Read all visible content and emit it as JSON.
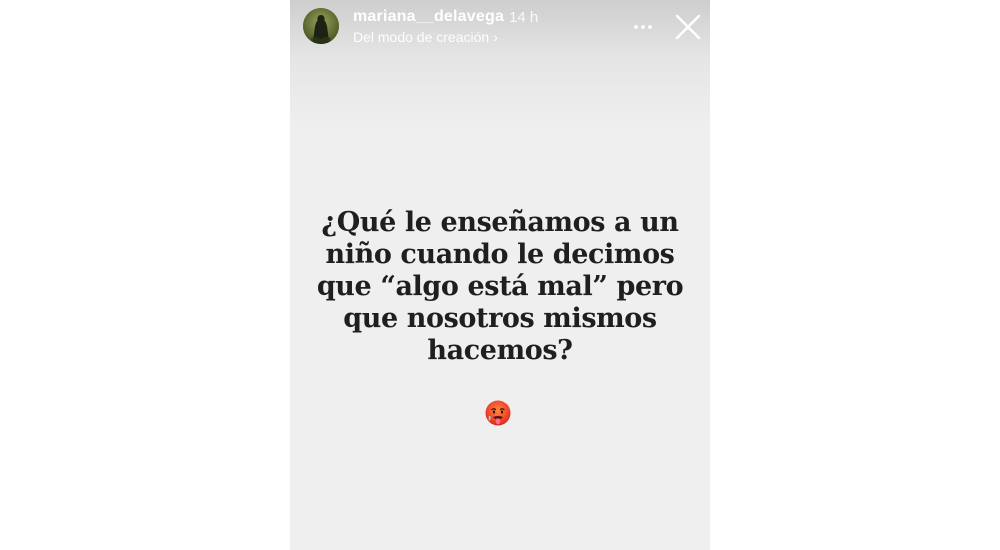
{
  "story": {
    "username": "mariana__delavega",
    "timestamp": "14 h",
    "subtitle": "Del modo de creación",
    "subtitle_chevron": "›",
    "question_lines": [
      "¿Qué le enseñamos a un",
      "niño cuando le decimos",
      "que “algo está mal” pero",
      "que nosotros mismos",
      "hacemos?"
    ],
    "emoji": "hot-face-emoji"
  },
  "icons": {
    "more": "more-horizontal-icon",
    "close": "close-icon"
  },
  "colors": {
    "story_background": "#efefef",
    "text": "#1f1f1f",
    "header_text": "#ffffff"
  }
}
